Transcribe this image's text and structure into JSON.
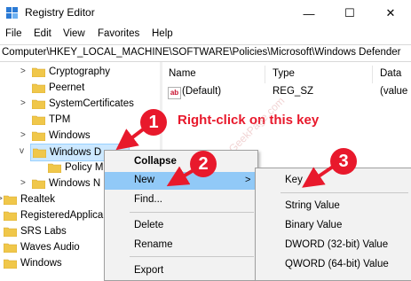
{
  "window": {
    "title": "Registry Editor",
    "controls": {
      "minimize": "—",
      "maximize": "☐",
      "close": "✕"
    }
  },
  "menu": [
    "File",
    "Edit",
    "View",
    "Favorites",
    "Help"
  ],
  "address": "Computer\\HKEY_LOCAL_MACHINE\\SOFTWARE\\Policies\\Microsoft\\Windows Defender",
  "tree": [
    {
      "label": "Cryptography",
      "expander": ">"
    },
    {
      "label": "Peernet",
      "expander": ""
    },
    {
      "label": "SystemCertificates",
      "expander": ">"
    },
    {
      "label": "TPM",
      "expander": ""
    },
    {
      "label": "Windows",
      "expander": ">"
    },
    {
      "label": "Windows D",
      "expander": "v"
    },
    {
      "label": "Policy M",
      "expander": ""
    },
    {
      "label": "Windows N",
      "expander": ">"
    },
    {
      "label": "Realtek",
      "expander": ">"
    },
    {
      "label": "RegisteredApplica",
      "expander": ""
    },
    {
      "label": "SRS Labs",
      "expander": ">"
    },
    {
      "label": "Waves Audio",
      "expander": ">"
    },
    {
      "label": "Windows",
      "expander": ">"
    }
  ],
  "list": {
    "columns": [
      "Name",
      "Type",
      "Data"
    ],
    "rows": [
      {
        "icon": "ab",
        "name": "(Default)",
        "type": "REG_SZ",
        "data": "(value"
      }
    ]
  },
  "context_menu": {
    "items": [
      "Collapse",
      "New",
      "Find...",
      "Delete",
      "Rename",
      "Export"
    ],
    "arrow": ">"
  },
  "submenu": {
    "items": [
      "Key",
      "String Value",
      "Binary Value",
      "DWORD (32-bit) Value",
      "QWORD (64-bit) Value"
    ]
  },
  "annotations": {
    "badge1": "1",
    "badge2": "2",
    "badge3": "3",
    "instruction": "Right-click on this key",
    "watermark": "www.TheGeekPage.com",
    "color": "#e8192c"
  },
  "colors": {
    "folder": "#f0c74a",
    "selection": "#cce8ff",
    "menu_highlight": "#91c9f7"
  }
}
